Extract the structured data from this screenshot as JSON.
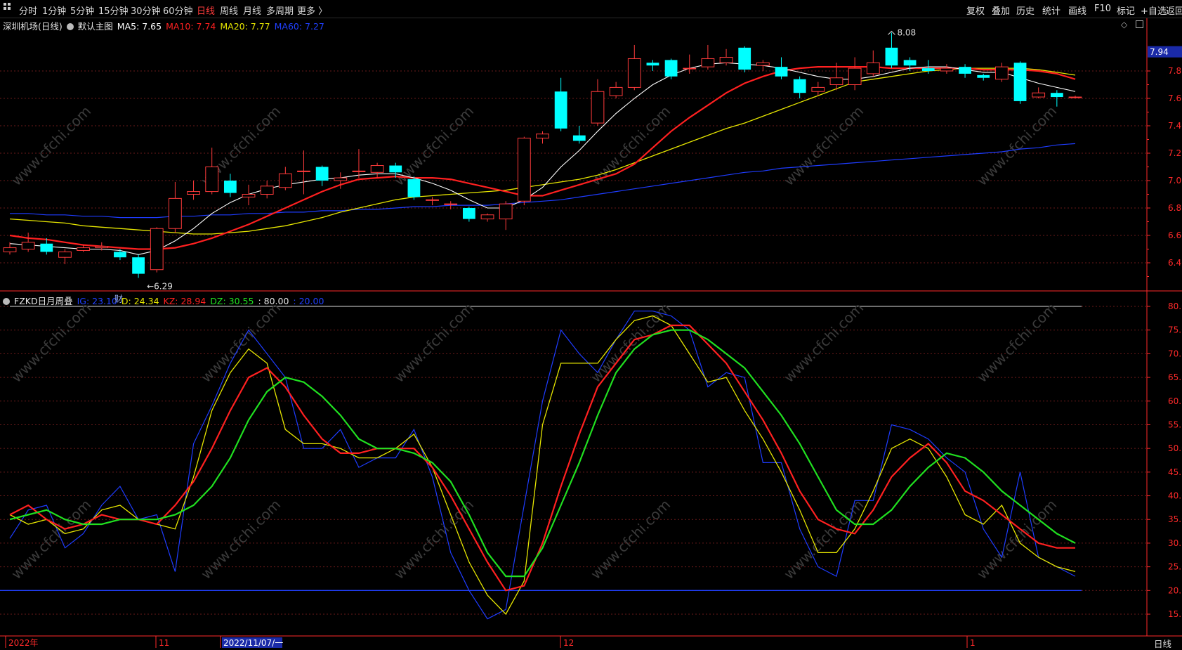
{
  "toolbar": {
    "periods": [
      {
        "label": "分时",
        "active": false
      },
      {
        "label": "1分钟",
        "active": false
      },
      {
        "label": "5分钟",
        "active": false
      },
      {
        "label": "15分钟",
        "active": false
      },
      {
        "label": "30分钟",
        "active": false
      },
      {
        "label": "60分钟",
        "active": false
      },
      {
        "label": "日线",
        "active": true
      },
      {
        "label": "周线",
        "active": false
      },
      {
        "label": "月线",
        "active": false
      },
      {
        "label": "多周期",
        "active": false
      },
      {
        "label": "更多 〉",
        "active": false
      }
    ],
    "tools": [
      "复权",
      "叠加",
      "历史",
      "统计",
      "画线",
      "F10",
      "标记",
      "+自选",
      "返回"
    ]
  },
  "main_legend": {
    "stock": "深圳机场(日线)",
    "template": "默认主图",
    "ma5": "MA5: 7.65",
    "ma10": "MA10: 7.74",
    "ma20": "MA20: 7.77",
    "ma60": "MA60: 7.27"
  },
  "indicator_legend": {
    "name": "FZKD日月周叠",
    "ig": "IG: 23.10",
    "d": "D: 24.34",
    "kz": "KZ: 28.94",
    "dz": "DZ: 30.55",
    "v80": ": 80.00",
    "v20": ": 20.00"
  },
  "colors": {
    "up": "#ff3b3b",
    "down": "#00ffff",
    "ma5": "#ffffff",
    "ma10": "#ff2020",
    "ma20": "#e6e600",
    "ma60": "#1e3cff",
    "ig": "#1e3cff",
    "d": "#e6e600",
    "kz": "#ff2020",
    "dz": "#20e020",
    "axis": "#ff2a2a",
    "grid": "#6a1a1a"
  },
  "price_axis": {
    "ticks": [
      "7.80",
      "7.60",
      "7.40",
      "7.20",
      "7.00",
      "6.80",
      "6.60",
      "6.40"
    ],
    "current": "7.94"
  },
  "indicator_axis": {
    "ticks": [
      "80.00",
      "75.00",
      "70.00",
      "65.00",
      "60.00",
      "55.00",
      "50.00",
      "45.00",
      "40.00",
      "35.00",
      "30.00",
      "25.00",
      "20.00",
      "15.00"
    ]
  },
  "date_axis": {
    "labels": [
      "2022年",
      "11",
      "2022/11/07/一",
      "12",
      "1"
    ]
  },
  "annotations": {
    "low": "←6.29",
    "high": "8.08",
    "badge": "财"
  },
  "watermark": "www.cfchi.com",
  "bottom_right": "日线",
  "chart_data": {
    "type": "candlestick",
    "candles": [
      {
        "o": 6.48,
        "c": 6.51,
        "h": 6.55,
        "l": 6.46
      },
      {
        "o": 6.5,
        "c": 6.55,
        "h": 6.62,
        "l": 6.48
      },
      {
        "o": 6.54,
        "c": 6.48,
        "h": 6.58,
        "l": 6.46
      },
      {
        "o": 6.44,
        "c": 6.48,
        "h": 6.5,
        "l": 6.39
      },
      {
        "o": 6.49,
        "c": 6.51,
        "h": 6.53,
        "l": 6.48
      },
      {
        "o": 6.51,
        "c": 6.52,
        "h": 6.55,
        "l": 6.49
      },
      {
        "o": 6.48,
        "c": 6.44,
        "h": 6.5,
        "l": 6.42
      },
      {
        "o": 6.44,
        "c": 6.32,
        "h": 6.46,
        "l": 6.29
      },
      {
        "o": 6.35,
        "c": 6.65,
        "h": 6.66,
        "l": 6.33
      },
      {
        "o": 6.65,
        "c": 6.87,
        "h": 6.99,
        "l": 6.62
      },
      {
        "o": 6.9,
        "c": 6.92,
        "h": 7.0,
        "l": 6.86
      },
      {
        "o": 6.92,
        "c": 7.1,
        "h": 7.24,
        "l": 6.9
      },
      {
        "o": 7.0,
        "c": 6.91,
        "h": 7.05,
        "l": 6.88
      },
      {
        "o": 6.88,
        "c": 6.9,
        "h": 6.97,
        "l": 6.82
      },
      {
        "o": 6.9,
        "c": 6.96,
        "h": 7.0,
        "l": 6.87
      },
      {
        "o": 6.95,
        "c": 7.05,
        "h": 7.1,
        "l": 6.93
      },
      {
        "o": 7.07,
        "c": 7.07,
        "h": 7.22,
        "l": 6.9
      },
      {
        "o": 7.1,
        "c": 7.0,
        "h": 7.11,
        "l": 6.96
      },
      {
        "o": 7.0,
        "c": 7.02,
        "h": 7.06,
        "l": 6.94
      },
      {
        "o": 7.07,
        "c": 7.07,
        "h": 7.23,
        "l": 7.02
      },
      {
        "o": 7.06,
        "c": 7.11,
        "h": 7.13,
        "l": 7.02
      },
      {
        "o": 7.11,
        "c": 7.06,
        "h": 7.13,
        "l": 7.02
      },
      {
        "o": 7.01,
        "c": 6.88,
        "h": 7.03,
        "l": 6.86
      },
      {
        "o": 6.86,
        "c": 6.86,
        "h": 6.88,
        "l": 6.82
      },
      {
        "o": 6.83,
        "c": 6.83,
        "h": 6.85,
        "l": 6.79
      },
      {
        "o": 6.8,
        "c": 6.72,
        "h": 6.81,
        "l": 6.7
      },
      {
        "o": 6.72,
        "c": 6.75,
        "h": 6.76,
        "l": 6.7
      },
      {
        "o": 6.72,
        "c": 6.83,
        "h": 6.85,
        "l": 6.64
      },
      {
        "o": 6.85,
        "c": 7.31,
        "h": 7.32,
        "l": 6.82
      },
      {
        "o": 7.31,
        "c": 7.34,
        "h": 7.36,
        "l": 7.27
      },
      {
        "o": 7.65,
        "c": 7.38,
        "h": 7.75,
        "l": 7.36
      },
      {
        "o": 7.33,
        "c": 7.29,
        "h": 7.4,
        "l": 7.27
      },
      {
        "o": 7.42,
        "c": 7.65,
        "h": 7.74,
        "l": 7.4
      },
      {
        "o": 7.62,
        "c": 7.68,
        "h": 7.72,
        "l": 7.6
      },
      {
        "o": 7.68,
        "c": 7.89,
        "h": 7.99,
        "l": 7.66
      },
      {
        "o": 7.86,
        "c": 7.84,
        "h": 7.88,
        "l": 7.8
      },
      {
        "o": 7.88,
        "c": 7.76,
        "h": 7.89,
        "l": 7.74
      },
      {
        "o": 7.82,
        "c": 7.82,
        "h": 7.92,
        "l": 7.78
      },
      {
        "o": 7.83,
        "c": 7.89,
        "h": 7.99,
        "l": 7.81
      },
      {
        "o": 7.86,
        "c": 7.9,
        "h": 7.96,
        "l": 7.84
      },
      {
        "o": 7.97,
        "c": 7.81,
        "h": 7.98,
        "l": 7.79
      },
      {
        "o": 7.84,
        "c": 7.86,
        "h": 7.88,
        "l": 7.8
      },
      {
        "o": 7.83,
        "c": 7.76,
        "h": 7.9,
        "l": 7.74
      },
      {
        "o": 7.74,
        "c": 7.64,
        "h": 7.76,
        "l": 7.6
      },
      {
        "o": 7.65,
        "c": 7.68,
        "h": 7.72,
        "l": 7.62
      },
      {
        "o": 7.7,
        "c": 7.75,
        "h": 7.86,
        "l": 7.66
      },
      {
        "o": 7.7,
        "c": 7.82,
        "h": 7.9,
        "l": 7.66
      },
      {
        "o": 7.78,
        "c": 7.86,
        "h": 7.95,
        "l": 7.76
      },
      {
        "o": 7.97,
        "c": 7.84,
        "h": 8.08,
        "l": 7.82
      },
      {
        "o": 7.88,
        "c": 7.84,
        "h": 7.9,
        "l": 7.8
      },
      {
        "o": 7.82,
        "c": 7.8,
        "h": 7.88,
        "l": 7.78
      },
      {
        "o": 7.8,
        "c": 7.82,
        "h": 7.85,
        "l": 7.78
      },
      {
        "o": 7.83,
        "c": 7.78,
        "h": 7.85,
        "l": 7.75
      },
      {
        "o": 7.77,
        "c": 7.75,
        "h": 7.78,
        "l": 7.73
      },
      {
        "o": 7.74,
        "c": 7.83,
        "h": 7.86,
        "l": 7.72
      },
      {
        "o": 7.86,
        "c": 7.58,
        "h": 7.87,
        "l": 7.56
      },
      {
        "o": 7.61,
        "c": 7.64,
        "h": 7.68,
        "l": 7.6
      },
      {
        "o": 7.64,
        "c": 7.61,
        "h": 7.66,
        "l": 7.54
      },
      {
        "o": 7.61,
        "c": 7.61,
        "h": 7.62,
        "l": 7.6
      }
    ],
    "ma5": [
      6.54,
      6.53,
      6.52,
      6.51,
      6.5,
      6.5,
      6.49,
      6.46,
      6.49,
      6.56,
      6.65,
      6.76,
      6.84,
      6.9,
      6.94,
      6.97,
      6.99,
      7.01,
      7.02,
      7.04,
      7.05,
      7.05,
      7.02,
      6.98,
      6.93,
      6.86,
      6.8,
      6.8,
      6.86,
      6.95,
      7.1,
      7.22,
      7.36,
      7.49,
      7.6,
      7.7,
      7.77,
      7.82,
      7.85,
      7.86,
      7.85,
      7.84,
      7.82,
      7.79,
      7.76,
      7.74,
      7.74,
      7.76,
      7.79,
      7.82,
      7.83,
      7.83,
      7.81,
      7.79,
      7.79,
      7.75,
      7.71,
      7.68,
      7.65
    ],
    "ma10": [
      6.6,
      6.58,
      6.57,
      6.55,
      6.53,
      6.52,
      6.51,
      6.5,
      6.5,
      6.51,
      6.54,
      6.58,
      6.63,
      6.68,
      6.74,
      6.8,
      6.86,
      6.92,
      6.97,
      7.01,
      7.02,
      7.03,
      7.02,
      7.02,
      7.01,
      6.98,
      6.95,
      6.92,
      6.89,
      6.89,
      6.93,
      6.97,
      7.01,
      7.05,
      7.12,
      7.24,
      7.36,
      7.46,
      7.55,
      7.64,
      7.71,
      7.76,
      7.8,
      7.82,
      7.83,
      7.83,
      7.83,
      7.83,
      7.82,
      7.82,
      7.82,
      7.82,
      7.82,
      7.81,
      7.81,
      7.81,
      7.8,
      7.78,
      7.74
    ],
    "ma20": [
      6.72,
      6.71,
      6.7,
      6.69,
      6.67,
      6.66,
      6.65,
      6.64,
      6.63,
      6.62,
      6.61,
      6.61,
      6.62,
      6.63,
      6.65,
      6.67,
      6.7,
      6.73,
      6.77,
      6.8,
      6.83,
      6.86,
      6.88,
      6.89,
      6.9,
      6.91,
      6.92,
      6.93,
      6.95,
      6.97,
      6.99,
      7.01,
      7.04,
      7.08,
      7.13,
      7.18,
      7.23,
      7.28,
      7.33,
      7.38,
      7.42,
      7.47,
      7.52,
      7.57,
      7.62,
      7.67,
      7.72,
      7.74,
      7.76,
      7.78,
      7.8,
      7.81,
      7.82,
      7.82,
      7.82,
      7.82,
      7.81,
      7.79,
      7.77
    ],
    "ma60": [
      6.76,
      6.76,
      6.75,
      6.75,
      6.74,
      6.74,
      6.73,
      6.73,
      6.73,
      6.74,
      6.74,
      6.75,
      6.75,
      6.76,
      6.76,
      6.77,
      6.77,
      6.78,
      6.78,
      6.79,
      6.79,
      6.8,
      6.81,
      6.81,
      6.82,
      6.82,
      6.82,
      6.83,
      6.84,
      6.85,
      6.86,
      6.88,
      6.9,
      6.92,
      6.94,
      6.96,
      6.98,
      7.0,
      7.02,
      7.04,
      7.06,
      7.07,
      7.09,
      7.1,
      7.11,
      7.12,
      7.13,
      7.14,
      7.15,
      7.16,
      7.17,
      7.18,
      7.19,
      7.2,
      7.21,
      7.23,
      7.24,
      7.26,
      7.27
    ],
    "ig": [
      31,
      37,
      38,
      29,
      32,
      38,
      42,
      35,
      36,
      24,
      51,
      59,
      68,
      75,
      70,
      65,
      50,
      50,
      54,
      46,
      48,
      48,
      54,
      44,
      28,
      20,
      14,
      16,
      38,
      60,
      75,
      70,
      66,
      73,
      79,
      79,
      78,
      75,
      63,
      66,
      65,
      47,
      47,
      33,
      25,
      23,
      39,
      39,
      55,
      54,
      52,
      48,
      45,
      33,
      27,
      45,
      27,
      25,
      23
    ],
    "d": [
      36,
      34,
      35,
      32,
      33,
      37,
      38,
      35,
      34,
      33,
      44,
      58,
      66,
      71,
      68,
      54,
      51,
      51,
      50,
      48,
      48,
      50,
      53,
      46,
      36,
      26,
      19,
      15,
      22,
      55,
      68,
      68,
      68,
      73,
      77,
      78,
      76,
      70,
      64,
      65,
      58,
      52,
      45,
      37,
      28,
      28,
      33,
      41,
      50,
      52,
      50,
      44,
      36,
      34,
      38,
      30,
      27,
      25,
      24
    ],
    "kz": [
      36,
      38,
      35,
      33,
      34,
      36,
      35,
      35,
      34,
      38,
      43,
      50,
      58,
      65,
      67,
      63,
      57,
      52,
      49,
      49,
      50,
      50,
      50,
      46,
      40,
      33,
      26,
      20,
      21,
      30,
      42,
      53,
      63,
      68,
      73,
      74,
      76,
      76,
      72,
      68,
      62,
      56,
      49,
      41,
      35,
      33,
      32,
      37,
      44,
      48,
      51,
      47,
      41,
      39,
      36,
      33,
      30,
      29,
      29
    ],
    "dz": [
      35,
      36,
      37,
      35,
      34,
      34,
      35,
      35,
      35,
      36,
      38,
      42,
      48,
      56,
      62,
      65,
      64,
      61,
      57,
      52,
      50,
      50,
      49,
      47,
      43,
      36,
      28,
      23,
      23,
      29,
      38,
      47,
      57,
      66,
      71,
      74,
      75,
      75,
      73,
      70,
      67,
      62,
      57,
      51,
      44,
      37,
      34,
      34,
      37,
      42,
      46,
      49,
      48,
      45,
      41,
      38,
      35,
      32,
      30
    ]
  }
}
